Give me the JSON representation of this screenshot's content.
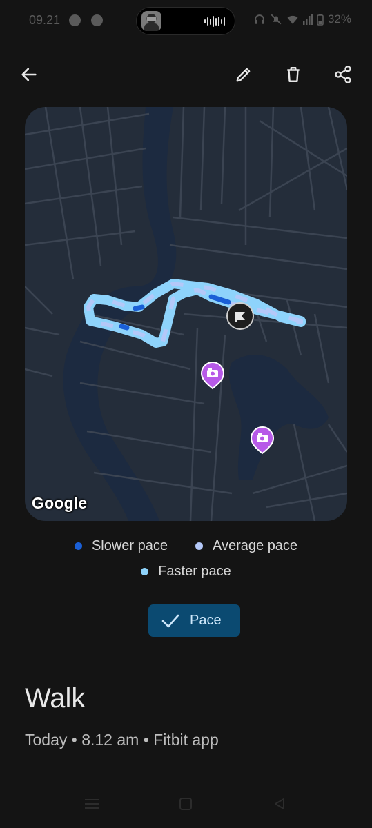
{
  "status_bar": {
    "time": "09.21",
    "battery": "32%"
  },
  "app_bar": {
    "back_icon": "arrow-left-icon",
    "edit_icon": "pencil-icon",
    "delete_icon": "trash-icon",
    "share_icon": "share-icon"
  },
  "map": {
    "attribution": "Google"
  },
  "legend": {
    "items": [
      {
        "label": "Slower pace",
        "color": "#1a5fd6"
      },
      {
        "label": "Average pace",
        "color": "#b4c8f8"
      },
      {
        "label": "Faster pace",
        "color": "#8ed3fb"
      }
    ]
  },
  "chip": {
    "label": "Pace",
    "selected": true
  },
  "activity": {
    "title": "Walk",
    "subtitle": "Today • 8.12 am • Fitbit app"
  },
  "colors": {
    "background": "#141414",
    "chip_bg": "#0b4a71",
    "photo_marker": "#b75ae8"
  }
}
